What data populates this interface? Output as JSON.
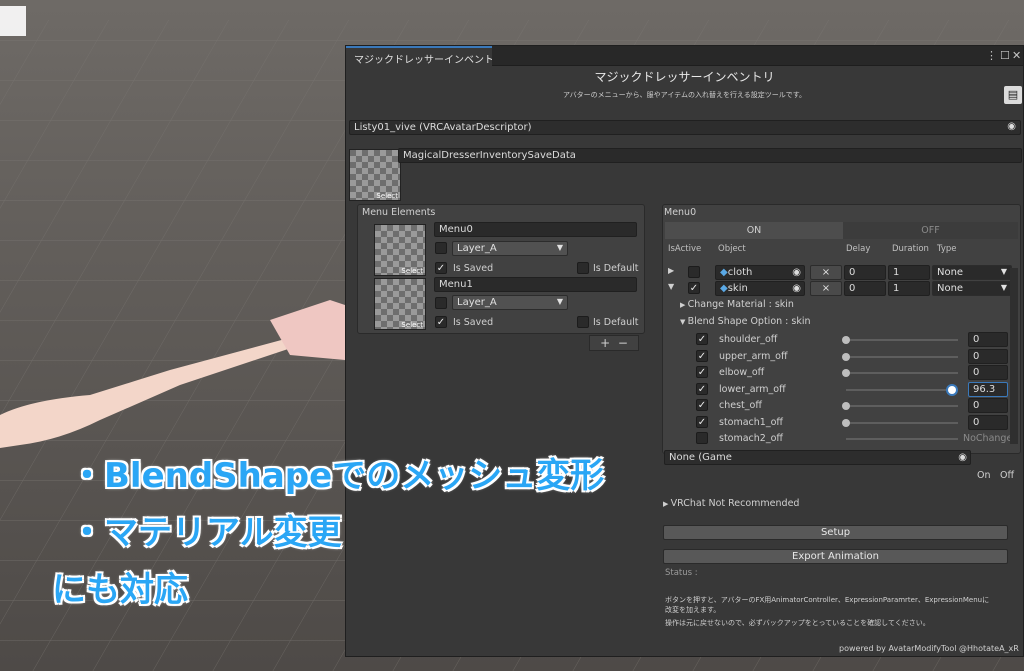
{
  "window": {
    "tab_title": "マジックドレッサーインベントリ(M...",
    "title": "マジックドレッサーインベントリ",
    "description": "アバターのメニューから、服やアイテムの入れ替えを行える設定ツールです。",
    "avatar_field": "Listy01_vive (VRCAvatarDescriptor)",
    "save_data": "MagicalDresserInventorySaveData",
    "thumb_select": "Select"
  },
  "menu": {
    "header": "Menu Elements",
    "items": [
      {
        "name": "Menu0",
        "layer": "Layer_A",
        "is_saved": "Is Saved",
        "is_default": "Is Default",
        "select": "Select"
      },
      {
        "name": "Menu1",
        "layer": "Layer_A",
        "is_saved": "Is Saved",
        "is_default": "Is Default",
        "select": "Select"
      }
    ],
    "add": "+",
    "remove": "−"
  },
  "detail": {
    "header": "Menu0",
    "tab_on": "ON",
    "tab_off": "OFF",
    "columns": {
      "isactive": "IsActive",
      "object": "Object",
      "delay": "Delay",
      "duration": "Duration",
      "type": "Type"
    },
    "rows": [
      {
        "object": "cloth",
        "x": "×",
        "delay": "0",
        "duration": "1",
        "type": "None"
      },
      {
        "object": "skin",
        "x": "×",
        "delay": "0",
        "duration": "1",
        "type": "None"
      }
    ],
    "change_material": "Change Material : skin",
    "blend_header": "Blend Shape Option : skin",
    "blendshapes": [
      {
        "name": "shoulder_off",
        "value": "0",
        "level": 0
      },
      {
        "name": "upper_arm_off",
        "value": "0",
        "level": 0
      },
      {
        "name": "elbow_off",
        "value": "0",
        "level": 0
      },
      {
        "name": "lower_arm_off",
        "value": "96.3",
        "level": 0.963
      },
      {
        "name": "chest_off",
        "value": "0",
        "level": 0
      },
      {
        "name": "stomach1_off",
        "value": "0",
        "level": 0
      },
      {
        "name": "stomach2_off",
        "value": "NoChange",
        "level": null
      }
    ],
    "none_field": "None (Game",
    "on": "On",
    "off": "Off"
  },
  "bottom": {
    "vrchat": "VRChat Not Recommended",
    "setup": "Setup",
    "export": "Export Animation",
    "status": "Status :",
    "note1": "ボタンを押すと、アバターのFX用AnimatorController、ExpressionParamrter、ExpressionMenuに",
    "note1b": "改変を加えます。",
    "note2": "操作は元に戻せないので、必ずバックアップをとっていることを確認してください。",
    "credit": "powered by AvatarModifyTool @HhotateA_xR"
  },
  "overlay": {
    "line1": "・BlendShapeでのメッシュ変形",
    "line2": "・マテリアル変更",
    "line3": "にも対応"
  }
}
